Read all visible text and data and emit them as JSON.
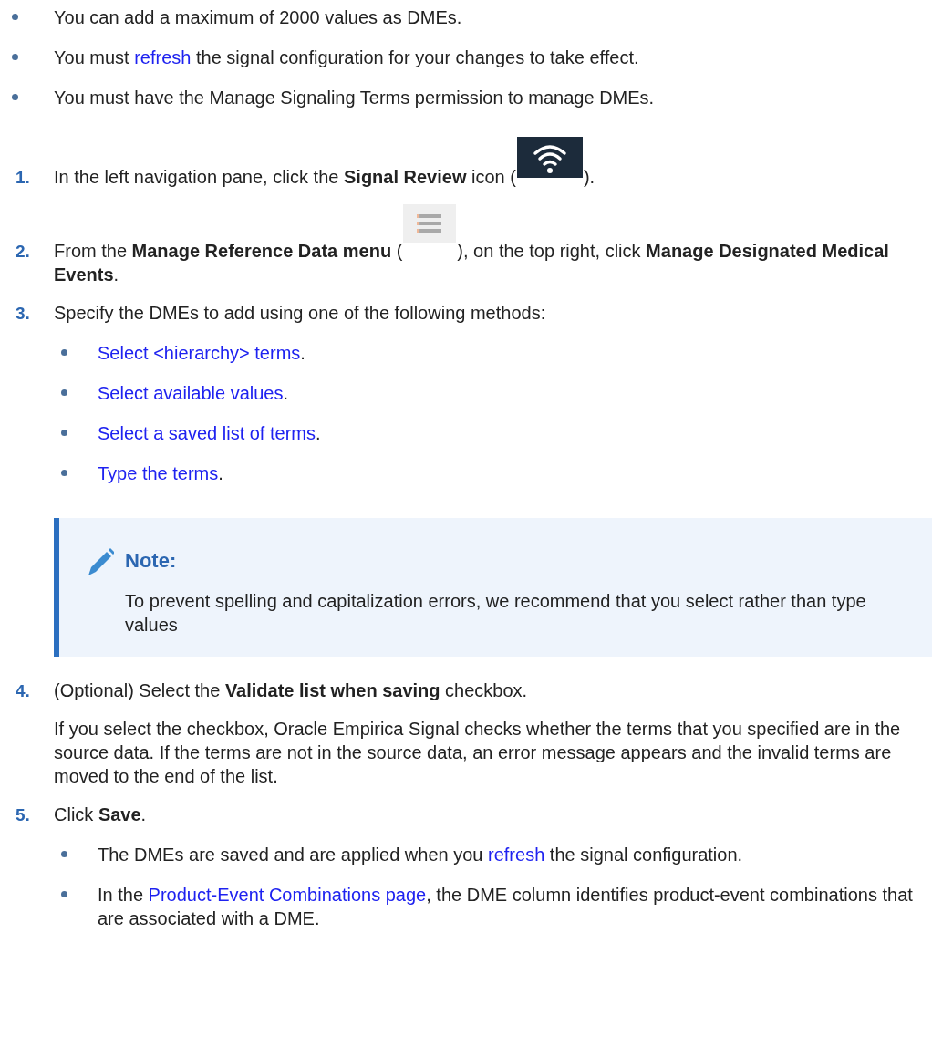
{
  "intro": [
    [
      {
        "kind": "text",
        "text": "You can add a maximum of 2000 values as DMEs."
      }
    ],
    [
      {
        "kind": "text",
        "text": "You must "
      },
      {
        "kind": "link",
        "text": "refresh"
      },
      {
        "kind": "text",
        "text": " the signal configuration for your changes to take effect."
      }
    ],
    [
      {
        "kind": "text",
        "text": "You must have the Manage Signaling Terms permission to manage DMEs."
      }
    ]
  ],
  "steps": [
    {
      "number": "1.",
      "text": [
        {
          "kind": "text",
          "text": "In the left navigation pane, click the "
        },
        {
          "kind": "bold",
          "text": "Signal Review"
        },
        {
          "kind": "text",
          "text": " icon ("
        },
        {
          "kind": "icon"
        },
        {
          "kind": "text",
          "text": ")."
        }
      ]
    },
    {
      "number": "2.",
      "text": [
        {
          "kind": "text",
          "text": "From the "
        },
        {
          "kind": "bold",
          "text": "Manage Reference Data menu"
        },
        {
          "kind": "text",
          "text": " ("
        },
        {
          "kind": "icon"
        },
        {
          "kind": "text",
          "text": "), on the top right, click "
        },
        {
          "kind": "bold",
          "text": "Manage Designated Medical Events"
        },
        {
          "kind": "text",
          "text": "."
        }
      ]
    },
    {
      "number": "3.",
      "text": [
        {
          "kind": "text",
          "text": "Specify the DMEs to add using one of the following methods:"
        }
      ],
      "subitems": [
        [
          {
            "kind": "link",
            "text": "Select <hierarchy> terms"
          },
          {
            "kind": "text",
            "text": "."
          }
        ],
        [
          {
            "kind": "link",
            "text": "Select available values"
          },
          {
            "kind": "text",
            "text": "."
          }
        ],
        [
          {
            "kind": "link",
            "text": "Select a saved list of terms"
          },
          {
            "kind": "text",
            "text": "."
          }
        ],
        [
          {
            "kind": "link",
            "text": "Type the terms"
          },
          {
            "kind": "text",
            "text": "."
          }
        ]
      ],
      "note": {
        "title": "Note:",
        "text": "To prevent spelling and capitalization errors, we recommend that you select rather than type values"
      }
    },
    {
      "number": "4.",
      "text": [
        {
          "kind": "text",
          "text": "(Optional) Select the "
        },
        {
          "kind": "bold",
          "text": "Validate list when saving"
        },
        {
          "kind": "text",
          "text": " checkbox."
        }
      ],
      "detail": [
        {
          "kind": "text",
          "text": "If you select the checkbox, Oracle Empirica Signal checks whether the terms that you specified are in the source data. If the terms are not in the source data, an error message appears and the invalid terms are moved to the end of the list."
        }
      ]
    },
    {
      "number": "5.",
      "text": [
        {
          "kind": "text",
          "text": "Click "
        },
        {
          "kind": "bold",
          "text": "Save"
        },
        {
          "kind": "text",
          "text": "."
        }
      ],
      "subitems": [
        [
          {
            "kind": "text",
            "text": "The DMEs are saved and are applied when you "
          },
          {
            "kind": "link",
            "text": "refresh"
          },
          {
            "kind": "text",
            "text": " the signal configuration."
          }
        ],
        [
          {
            "kind": "text",
            "text": "In the "
          },
          {
            "kind": "link",
            "text": "Product-Event Combinations page"
          },
          {
            "kind": "text",
            "text": ", the DME column identifies product-event combinations that are associated with a DME."
          }
        ]
      ]
    }
  ]
}
